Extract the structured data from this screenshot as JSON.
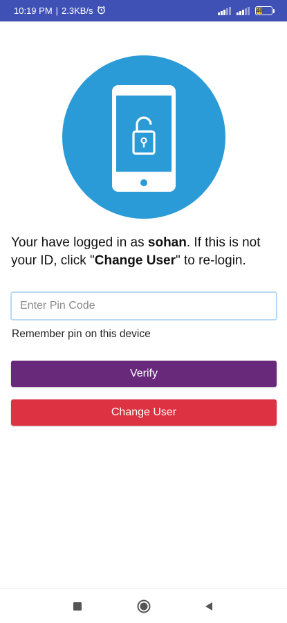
{
  "status_bar": {
    "time": "10:19 PM",
    "separator": "|",
    "speed": "2.3KB/s",
    "battery_level": "40"
  },
  "colors": {
    "status_bar": "#3f51b5",
    "hero_circle": "#2b9bd8",
    "verify_button": "#68297a",
    "change_button": "#dd3241"
  },
  "hero": {
    "icon": "phone-unlock-icon"
  },
  "message": {
    "part1": "Your have logged in as ",
    "username": "sohan",
    "part2": ". If this is not your ID, click \"",
    "change_user_ref": "Change User",
    "part3": "\" to re-login."
  },
  "pin": {
    "placeholder": "Enter Pin Code",
    "value": ""
  },
  "remember_label": "Remember pin on this device",
  "buttons": {
    "verify": "Verify",
    "change_user": "Change User"
  },
  "nav": {
    "recent_icon": "square-icon",
    "home_icon": "circle-icon",
    "back_icon": "triangle-back-icon"
  }
}
